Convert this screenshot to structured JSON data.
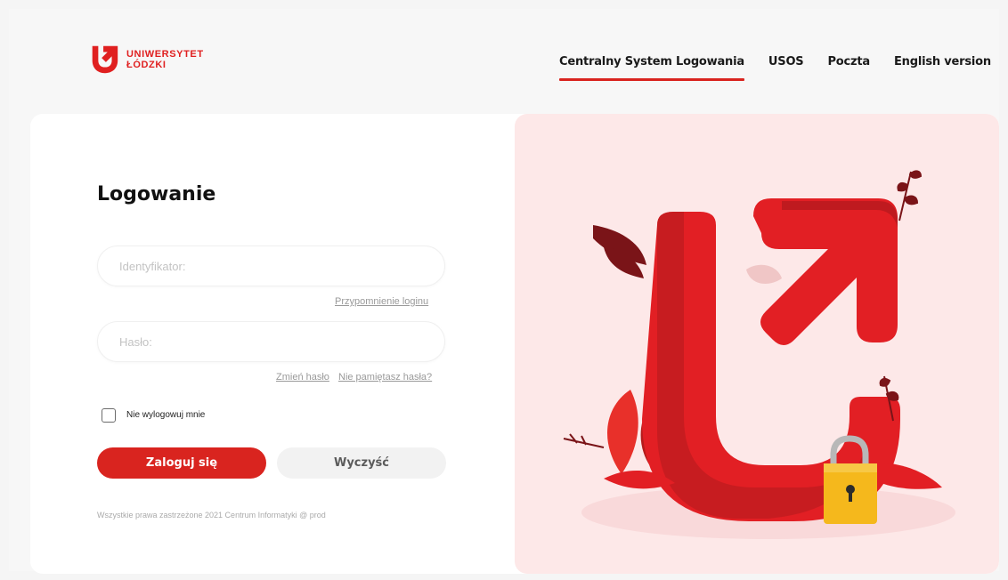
{
  "header": {
    "logo_line1": "UNIWERSYTET",
    "logo_line2": "ŁÓDZKI",
    "nav": [
      {
        "label": "Centralny System Logowania",
        "active": true
      },
      {
        "label": "USOS",
        "active": false
      },
      {
        "label": "Poczta",
        "active": false
      },
      {
        "label": "English version",
        "active": false
      }
    ]
  },
  "login": {
    "title": "Logowanie",
    "id_placeholder": "Identyfikator:",
    "id_value": "",
    "remind_login": "Przypomnienie loginu",
    "password_placeholder": "Hasło:",
    "password_value": "",
    "change_password": "Zmień hasło",
    "forgot_password": "Nie pamiętasz hasła?",
    "remember_label": "Nie wylogowuj mnie",
    "remember_checked": false,
    "login_button": "Zaloguj się",
    "clear_button": "Wyczyść",
    "footer": "Wszystkie prawa zastrzeżone 2021 Centrum Informatyki @ prod"
  },
  "colors": {
    "accent": "#d9241f",
    "art_background": "#fde8e8",
    "lock": "#f5b81c"
  },
  "icons": {
    "logo": "university-logo-icon",
    "illustration": "arrow-u-lock-illustration",
    "lock": "padlock-icon"
  }
}
